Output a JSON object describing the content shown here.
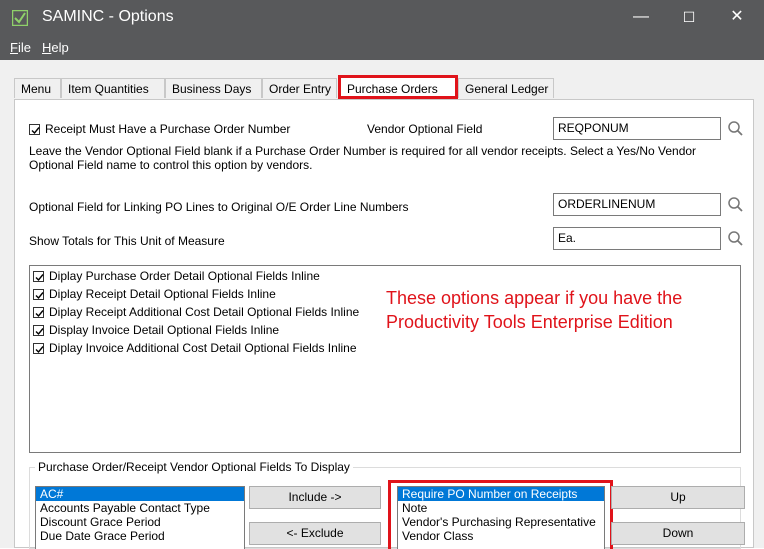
{
  "window": {
    "title": "SAMINC - Options",
    "minimize": "—",
    "maximize": "☐",
    "close": "✕"
  },
  "menu": {
    "file": "File",
    "help": "Help"
  },
  "tabs": [
    {
      "label": "Menu"
    },
    {
      "label": "Item Quantities"
    },
    {
      "label": "Business Days"
    },
    {
      "label": "Order Entry"
    },
    {
      "label": "Purchase Orders"
    },
    {
      "label": "General Ledger"
    }
  ],
  "po": {
    "receipt_must_have_label": "Receipt Must Have a Purchase Order Number",
    "receipt_must_have_checked": true,
    "vendor_optional_field_label": "Vendor Optional Field",
    "vendor_optional_field_value": "REQPONUM",
    "note": "Leave the Vendor Optional Field blank if a Purchase Order Number is required for all vendor receipts. Select a Yes/No Vendor Optional Field name to control this option by vendors.",
    "linking_label": "Optional Field for Linking PO Lines to Original O/E Order Line Numbers",
    "linking_value": "ORDERLINENUM",
    "uom_label": "Show Totals for This Unit of Measure",
    "uom_value": "Ea.",
    "inline_options": [
      "Diplay Purchase Order Detail Optional Fields Inline",
      "Diplay Receipt Detail Optional Fields Inline",
      "Diplay Receipt Additional Cost Detail Optional Fields Inline",
      "Display Invoice Detail Optional Fields Inline",
      "Diplay Invoice Additional Cost Detail Optional Fields Inline"
    ],
    "annotation_line1": "These options appear if you have the",
    "annotation_line2": "Productivity Tools Enterprise Edition",
    "group_title": "Purchase Order/Receipt Vendor Optional Fields To Display",
    "available_fields": [
      "AC#",
      "Accounts Payable Contact Type",
      "Discount Grace Period",
      "Due Date Grace Period"
    ],
    "selected_fields": [
      "Require PO Number on Receipts",
      "Note",
      "Vendor's Purchasing Representative",
      "Vendor Class"
    ],
    "include_label": "Include ->",
    "exclude_label": "<- Exclude",
    "up_label": "Up",
    "down_label": "Down"
  },
  "colors": {
    "highlight_red": "#e0131a",
    "titlebar": "#58595b",
    "selection": "#0078d7"
  }
}
